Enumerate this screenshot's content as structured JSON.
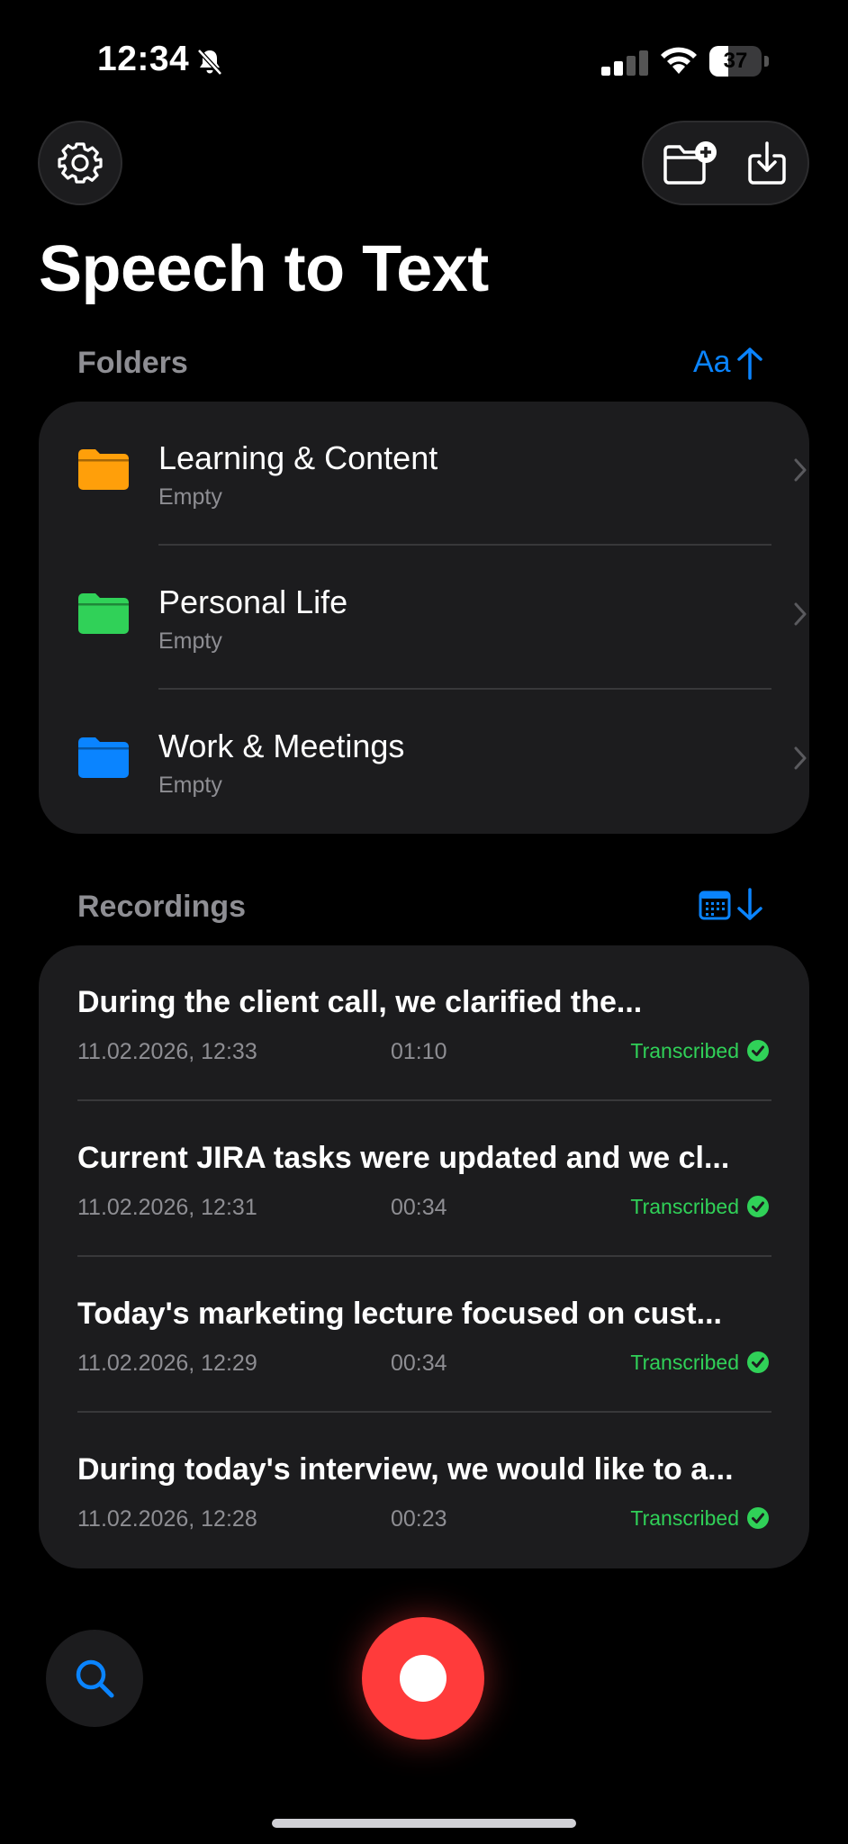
{
  "status_bar": {
    "time": "12:34",
    "battery": "37",
    "battery_level": 0.37
  },
  "header": {
    "title": "Speech to Text"
  },
  "folders": {
    "label": "Folders",
    "sort_label": "Aa",
    "items": [
      {
        "name": "Learning & Content",
        "subtitle": "Empty",
        "color": "#ff9f0a"
      },
      {
        "name": "Personal Life",
        "subtitle": "Empty",
        "color": "#30d158"
      },
      {
        "name": "Work & Meetings",
        "subtitle": "Empty",
        "color": "#0a84ff"
      }
    ]
  },
  "recordings": {
    "label": "Recordings",
    "items": [
      {
        "title": "During the client call, we clarified the...",
        "date": "11.02.2026, 12:33",
        "duration": "01:10",
        "status": "Transcribed"
      },
      {
        "title": "Current JIRA tasks were updated and we cl...",
        "date": "11.02.2026, 12:31",
        "duration": "00:34",
        "status": "Transcribed"
      },
      {
        "title": "Today's marketing lecture focused on cust...",
        "date": "11.02.2026, 12:29",
        "duration": "00:34",
        "status": "Transcribed"
      },
      {
        "title": "During today's interview, we would like to a...",
        "date": "11.02.2026, 12:28",
        "duration": "00:23",
        "status": "Transcribed"
      }
    ]
  },
  "icons": {
    "settings": "gear-icon",
    "new_folder": "folder-plus-icon",
    "import": "download-tray-icon",
    "sort_folders": "sort-ascending-icon",
    "sort_recordings": "calendar-sort-descending-icon",
    "search": "search-icon",
    "record": "record-icon"
  },
  "colors": {
    "accent": "#0a84ff",
    "record": "#ff3b3b",
    "transcribed": "#30d158"
  }
}
